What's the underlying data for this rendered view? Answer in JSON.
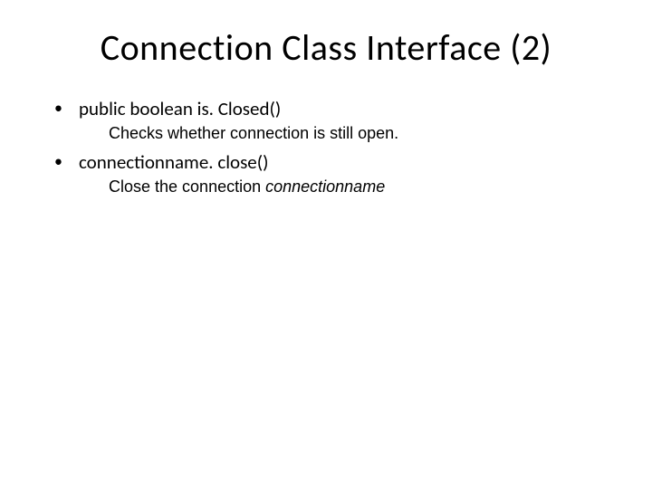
{
  "slide": {
    "title": "Connection Class Interface (2)",
    "items": [
      {
        "method": "public boolean is. Closed()",
        "description_prefix": "Checks whether connection is still open.",
        "description_italic": ""
      },
      {
        "method": "connectionname. close()",
        "description_prefix": "Close the connection ",
        "description_italic": "connectionname"
      }
    ]
  }
}
